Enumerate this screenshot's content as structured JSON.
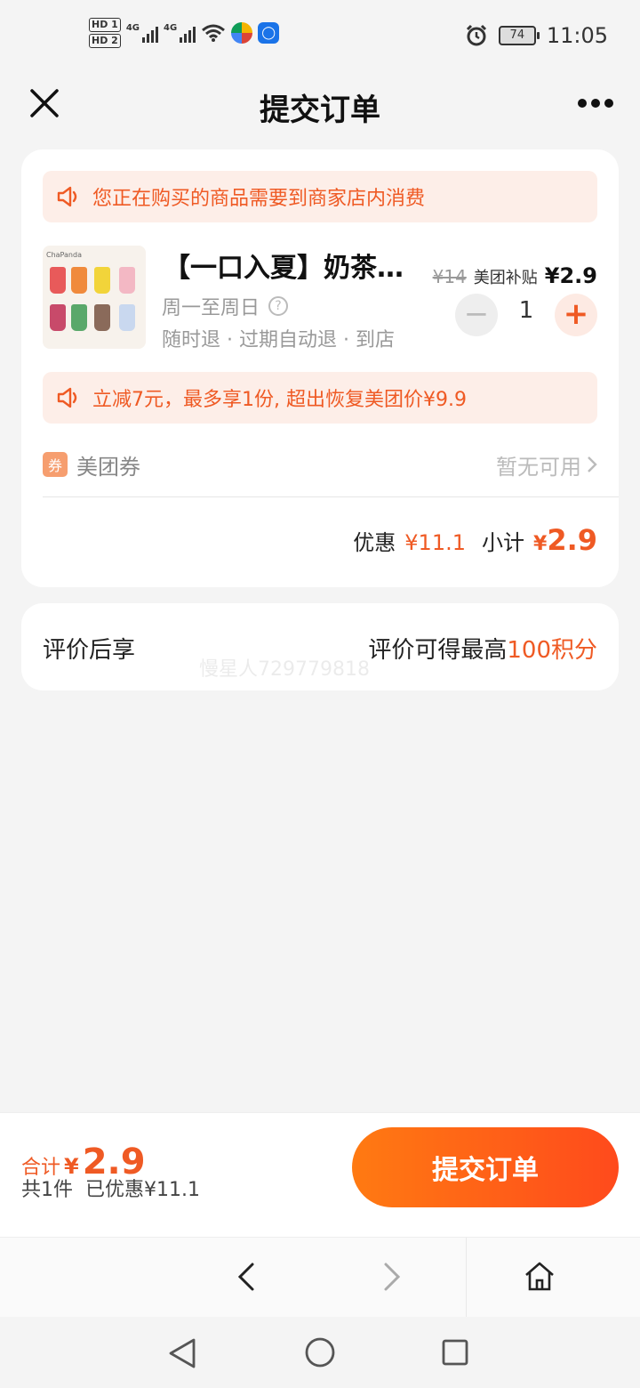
{
  "status_bar": {
    "hd1": "HD 1",
    "hd2": "HD 2",
    "net1": "4G",
    "net2": "4G",
    "battery": "74",
    "time": "11:05"
  },
  "header": {
    "title": "提交订单"
  },
  "order": {
    "notice_store": "您正在购买的商品需要到商家店内消费",
    "product": {
      "title": "【一口入夏】奶茶…",
      "image_brand": "ChaPanda",
      "days": "周一至周日",
      "rules": "随时退 · 过期自动退 · 到店",
      "original_price": "¥14",
      "subsidy_label": "美团补贴",
      "final_price": "¥2.9",
      "quantity": "1",
      "minus": "−",
      "plus": "+"
    },
    "notice_discount": "立减7元，最多享1份, 超出恢复美团价¥9.9",
    "coupon": {
      "badge": "券",
      "label": "美团券",
      "status": "暂无可用"
    },
    "summary": {
      "discount_label": "优惠",
      "discount_value": "¥11.1",
      "subtotal_label": "小计",
      "subtotal_yen": "¥",
      "subtotal_value": "2.9"
    }
  },
  "review": {
    "left": "评价后享",
    "right_prefix": "评价可得最高",
    "right_points": "100积分",
    "watermark": "慢星人72977981​8"
  },
  "bottom_bar": {
    "total_label": "合计",
    "total_yen": "¥",
    "total_value": "2.9",
    "count_text": "共1件",
    "saved_text": "已优惠¥11.1",
    "submit_label": "提交订单"
  },
  "colors": {
    "accent": "#ef5a24",
    "button_start": "#ff7a12",
    "button_end": "#ff4a1c",
    "notice_bg": "#fdeee8"
  }
}
